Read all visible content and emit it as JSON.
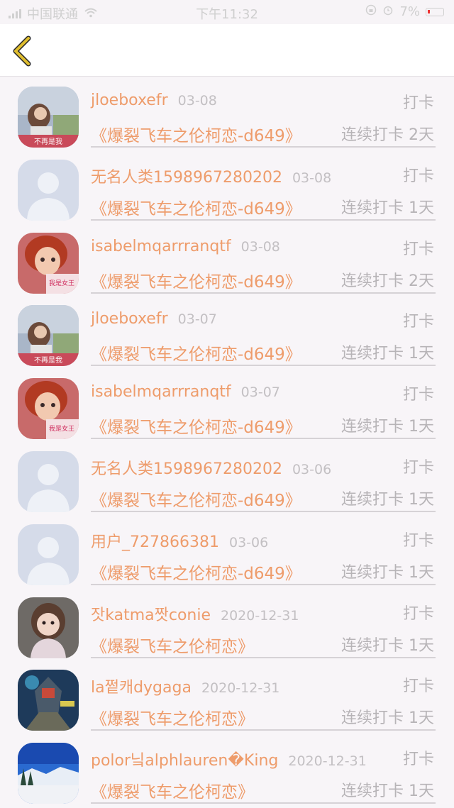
{
  "status": {
    "carrier": "中国联通",
    "time": "下午11:32",
    "battery": "7%"
  },
  "entries": [
    {
      "name": "jloeboxefr",
      "date": "03-08",
      "action": "打卡",
      "book": "《爆裂飞车之伦柯恋-d649》",
      "streak": "连续打卡 2天",
      "avatar": "avatar-girl-field"
    },
    {
      "name": "无名人类1598967280202",
      "date": "03-08",
      "action": "打卡",
      "book": "《爆裂飞车之伦柯恋-d649》",
      "streak": "连续打卡 1天",
      "avatar": "avatar-default"
    },
    {
      "name": "isabelmqarrranqtf",
      "date": "03-08",
      "action": "打卡",
      "book": "《爆裂飞车之伦柯恋-d649》",
      "streak": "连续打卡 2天",
      "avatar": "avatar-redhair"
    },
    {
      "name": "jloeboxefr",
      "date": "03-07",
      "action": "打卡",
      "book": "《爆裂飞车之伦柯恋-d649》",
      "streak": "连续打卡 1天",
      "avatar": "avatar-girl-field"
    },
    {
      "name": "isabelmqarrranqtf",
      "date": "03-07",
      "action": "打卡",
      "book": "《爆裂飞车之伦柯恋-d649》",
      "streak": "连续打卡 1天",
      "avatar": "avatar-redhair"
    },
    {
      "name": "无名人类1598967280202",
      "date": "03-06",
      "action": "打卡",
      "book": "《爆裂飞车之伦柯恋-d649》",
      "streak": "连续打卡 1天",
      "avatar": "avatar-default"
    },
    {
      "name": "用户_727866381",
      "date": "03-06",
      "action": "打卡",
      "book": "《爆裂飞车之伦柯恋-d649》",
      "streak": "连续打卡 1天",
      "avatar": "avatar-default"
    },
    {
      "name": "잣katma짯conie",
      "date": "2020-12-31",
      "action": "打卡",
      "book": "《爆裂飞车之伦柯恋》",
      "streak": "连续打卡 1天",
      "avatar": "avatar-child"
    },
    {
      "name": "la쩥캐dygaga",
      "date": "2020-12-31",
      "action": "打卡",
      "book": "《爆裂飞车之伦柯恋》",
      "streak": "连续打卡 1天",
      "avatar": "avatar-robot"
    },
    {
      "name": "polor닠alphlauren�King",
      "date": "2020-12-31",
      "action": "打卡",
      "book": "《爆裂飞车之伦柯恋》",
      "streak": "连续打卡 1天",
      "avatar": "avatar-snow"
    }
  ],
  "colors": {
    "accent": "#ee9c6b",
    "muted": "#b7b4b7",
    "back_icon": "#e0be2e"
  }
}
